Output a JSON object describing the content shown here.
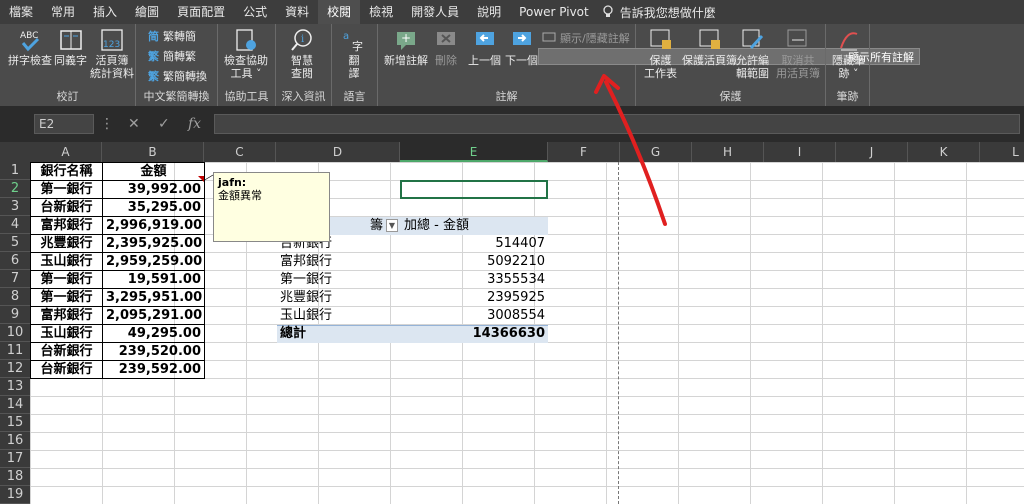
{
  "menu": {
    "tabs": [
      "檔案",
      "常用",
      "插入",
      "繪圖",
      "頁面配置",
      "公式",
      "資料",
      "校閱",
      "檢視",
      "開發人員",
      "說明",
      "Power Pivot"
    ],
    "active_tab": "校閱",
    "tell_me": "告訴我您想做什麼"
  },
  "ribbon": {
    "proofing": {
      "label": "校訂",
      "spell": "拼字檢查",
      "thesaurus": "同義字",
      "stats_l1": "活頁簿",
      "stats_l2": "統計資料"
    },
    "chinese": {
      "label": "中文繁簡轉換",
      "to_trad": "繁轉簡",
      "to_simp": "簡轉繁",
      "convert": "繁簡轉換"
    },
    "access": {
      "label": "協助工具",
      "check_l1": "檢查協助",
      "check_l2": "工具 ˅"
    },
    "insights": {
      "label": "深入資訊",
      "l1": "智慧",
      "l2": "查閱"
    },
    "language": {
      "label": "語言",
      "l1": "翻",
      "l2": "譯"
    },
    "comments": {
      "label": "註解",
      "new": "新增註解",
      "delete": "刪除",
      "prev": "上一個",
      "next": "下一個",
      "show_hide": "顯示/隱藏註解",
      "show_all": "顯示所有註解"
    },
    "protect": {
      "label": "保護",
      "sheet_l1": "保護",
      "sheet_l2": "工作表",
      "book": "保護活頁簿",
      "allow_l1": "允許編",
      "allow_l2": "輯範圍",
      "unshare_l1": "取消共",
      "unshare_l2": "用活頁簿"
    },
    "ink": {
      "label": "筆跡",
      "l1": "隱藏筆",
      "l2": "跡 ˅"
    }
  },
  "formula_bar": {
    "name_box": "E2",
    "value": ""
  },
  "columns": [
    "A",
    "B",
    "C",
    "D",
    "E",
    "F",
    "G",
    "H",
    "I",
    "J",
    "K",
    "L"
  ],
  "rows": [
    "1",
    "2",
    "3",
    "4",
    "5",
    "6",
    "7",
    "8",
    "9",
    "10",
    "11",
    "12",
    "13",
    "14",
    "15",
    "16",
    "17",
    "18",
    "19"
  ],
  "table": {
    "header_a": "銀行名稱",
    "header_b": "金額",
    "rows": [
      {
        "bank": "第一銀行",
        "amount": "39,992.00"
      },
      {
        "bank": "台新銀行",
        "amount": "35,295.00"
      },
      {
        "bank": "富邦銀行",
        "amount": "2,996,919.00"
      },
      {
        "bank": "兆豐銀行",
        "amount": "2,395,925.00"
      },
      {
        "bank": "玉山銀行",
        "amount": "2,959,259.00"
      },
      {
        "bank": "第一銀行",
        "amount": "19,591.00"
      },
      {
        "bank": "第一銀行",
        "amount": "3,295,951.00"
      },
      {
        "bank": "富邦銀行",
        "amount": "2,095,291.00"
      },
      {
        "bank": "玉山銀行",
        "amount": "49,295.00"
      },
      {
        "bank": "台新銀行",
        "amount": "239,520.00"
      },
      {
        "bank": "台新銀行",
        "amount": "239,592.00"
      }
    ]
  },
  "comment": {
    "author": "jafn:",
    "text": "金額異常"
  },
  "pivot": {
    "row_label_partial": "籌",
    "value_header": "加總 - 金額",
    "rows": [
      {
        "bank": "台新銀行",
        "value": "514407"
      },
      {
        "bank": "富邦銀行",
        "value": "5092210"
      },
      {
        "bank": "第一銀行",
        "value": "3355534"
      },
      {
        "bank": "兆豐銀行",
        "value": "2395925"
      },
      {
        "bank": "玉山銀行",
        "value": "3008554"
      }
    ],
    "total_label": "總計",
    "total_value": "14366630"
  },
  "colors": {
    "accent_red": "#e02020",
    "selection_green": "#217346"
  }
}
